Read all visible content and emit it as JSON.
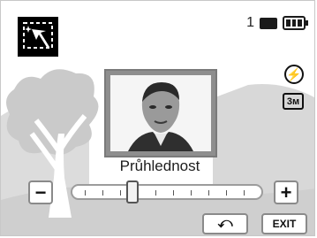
{
  "status": {
    "shots_remaining": "1",
    "card_icon": "memory-card-icon",
    "battery_icon": "battery-full-icon"
  },
  "side_icons": {
    "flash_symbol": "⚡",
    "size_label": "3м"
  },
  "mode_icon": "magic-frame-icon",
  "adjust": {
    "label": "Průhlednost",
    "minus": "−",
    "plus": "+",
    "value_fraction": 0.32
  },
  "buttons": {
    "back_symbol": "⤺",
    "exit_label": "EXIT"
  },
  "colors": {
    "background": "#ffffff",
    "landscape": "#cfcfcf"
  }
}
